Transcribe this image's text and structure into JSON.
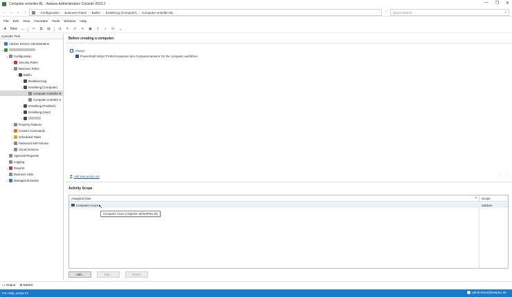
{
  "window": {
    "title": "Computer erstellen BL - Adaxes Administration Console 2023.2",
    "controls": [
      "—",
      "❐",
      "✕"
    ]
  },
  "address": {
    "breadcrumbs": [
      "Configuration",
      "Business Rules",
      "Builtin",
      "Erstellung (Computer)",
      "Computer erstellen BL"
    ],
    "search_placeholder": "Quick Search"
  },
  "menu": [
    "File",
    "Edit",
    "View",
    "Favorites",
    "Tools",
    "Window",
    "Help"
  ],
  "toolbar": {
    "new_label": "New"
  },
  "console_tree": {
    "header": "Console Tree",
    "items": [
      {
        "label": "Adaxes Service Administration",
        "indent": 0,
        "icon": "blue",
        "exp": ""
      },
      {
        "label": "",
        "blurred": true,
        "indent": 0,
        "icon": "green",
        "exp": "⌄"
      },
      {
        "label": "Configuration",
        "indent": 1,
        "icon": "grey",
        "exp": "⌄"
      },
      {
        "label": "Security Roles",
        "indent": 2,
        "icon": "red",
        "exp": "›"
      },
      {
        "label": "Business Rules",
        "indent": 2,
        "icon": "grey",
        "exp": "⌄"
      },
      {
        "label": "Builtin",
        "indent": 3,
        "icon": "folder",
        "exp": "⌄"
      },
      {
        "label": "Deaktivierung",
        "indent": 4,
        "icon": "folder",
        "exp": "›"
      },
      {
        "label": "Erstellung (Computer)",
        "indent": 4,
        "icon": "folder",
        "exp": "⌄"
      },
      {
        "label": "Computer erstellen B",
        "indent": 5,
        "icon": "grey",
        "exp": "",
        "selected": true
      },
      {
        "label": "Computer erstellen K",
        "indent": 5,
        "icon": "grey",
        "exp": ""
      },
      {
        "label": "Erstellung (Postfach)",
        "indent": 4,
        "icon": "folder",
        "exp": "›"
      },
      {
        "label": "Erstellung (User)",
        "indent": 4,
        "icon": "folder",
        "exp": "›"
      },
      {
        "label": "",
        "blurred": true,
        "short": true,
        "indent": 4,
        "icon": "folder",
        "exp": "›"
      },
      {
        "label": "Property Patterns",
        "indent": 2,
        "icon": "grey",
        "exp": "›"
      },
      {
        "label": "Custom Commands",
        "indent": 2,
        "icon": "orange",
        "exp": "›"
      },
      {
        "label": "Scheduled Tasks",
        "indent": 2,
        "icon": "yellow",
        "exp": "›"
      },
      {
        "label": "Password Self-Service",
        "indent": 2,
        "icon": "grey",
        "exp": "›"
      },
      {
        "label": "Cloud Services",
        "indent": 2,
        "icon": "grey",
        "exp": "›"
      },
      {
        "label": "Approval Requests",
        "indent": 1,
        "icon": "grey",
        "exp": ""
      },
      {
        "label": "Logging",
        "indent": 1,
        "icon": "grey",
        "exp": ""
      },
      {
        "label": "Reports",
        "indent": 1,
        "icon": "red",
        "exp": "›"
      },
      {
        "label": "Business Units",
        "indent": 1,
        "icon": "grey",
        "exp": ""
      },
      {
        "label": "Managed Domains",
        "indent": 1,
        "icon": "blue",
        "exp": "›"
      }
    ]
  },
  "rule": {
    "header": "Before creating a computer:",
    "condition": "Always",
    "action": "PowerShell-Skript 'Prüfen/Anpassen des Computernamens' für the computer ausführen",
    "add_action_set": "Add new action set"
  },
  "activity_scope": {
    "title": "Activity Scope",
    "columns": {
      "assigned": "Assigned Over",
      "scope": "Scope"
    },
    "rows": [
      {
        "assigned": "Computer-Azure",
        "scope": "Subtree"
      }
    ],
    "tooltip": "Computer-Azure (netgheim.de\\NetPlex.de)",
    "buttons": {
      "add": "Add...",
      "edit": "Edit...",
      "delete": "Delete"
    }
  },
  "bottom_tabs": [
    "Output",
    "Basket"
  ],
  "status": {
    "left": "For Help, press F1",
    "user": "admin-kene@netplex.de"
  }
}
